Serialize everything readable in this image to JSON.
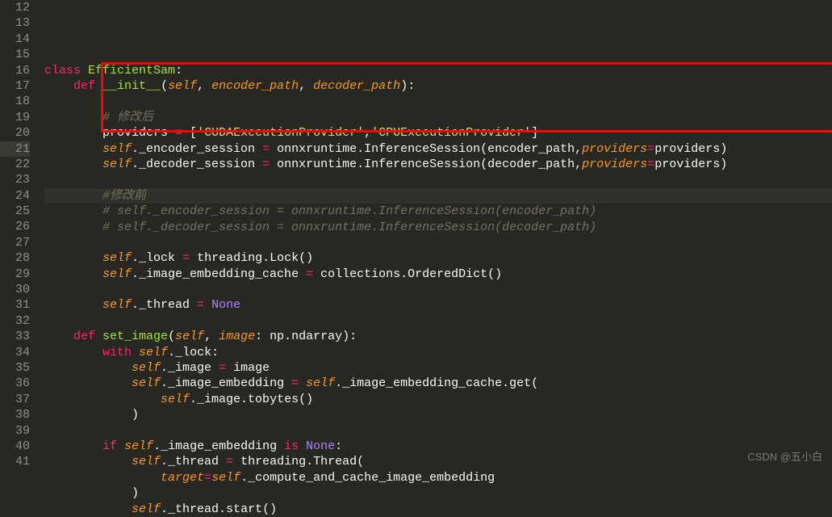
{
  "watermark": "CSDN @五小白",
  "lines": [
    {
      "num": "12",
      "tokens": []
    },
    {
      "num": "13",
      "tokens": [
        {
          "c": "kw",
          "t": "class"
        },
        {
          "c": "txt",
          "t": " "
        },
        {
          "c": "cls",
          "t": "EfficientSam"
        },
        {
          "c": "pun",
          "t": ":"
        }
      ]
    },
    {
      "num": "14",
      "tokens": [
        {
          "c": "txt",
          "t": "    "
        },
        {
          "c": "kw",
          "t": "def"
        },
        {
          "c": "txt",
          "t": " "
        },
        {
          "c": "fn",
          "t": "__init__"
        },
        {
          "c": "pun",
          "t": "("
        },
        {
          "c": "prm",
          "t": "self"
        },
        {
          "c": "pun",
          "t": ", "
        },
        {
          "c": "prm",
          "t": "encoder_path"
        },
        {
          "c": "pun",
          "t": ", "
        },
        {
          "c": "prm",
          "t": "decoder_path"
        },
        {
          "c": "pun",
          "t": "):"
        }
      ]
    },
    {
      "num": "15",
      "tokens": []
    },
    {
      "num": "16",
      "tokens": [
        {
          "c": "txt",
          "t": "        "
        },
        {
          "c": "cmt",
          "t": "# 修改后"
        }
      ]
    },
    {
      "num": "17",
      "tokens": [
        {
          "c": "txt",
          "t": "        providers "
        },
        {
          "c": "op",
          "t": "="
        },
        {
          "c": "txt",
          "t": " ["
        },
        {
          "c": "str",
          "t": "'CUDAExecutionProvider'"
        },
        {
          "c": "pun",
          "t": ","
        },
        {
          "c": "str",
          "t": "'CPUExecutionProvider'"
        },
        {
          "c": "pun",
          "t": "]"
        }
      ]
    },
    {
      "num": "18",
      "tokens": [
        {
          "c": "txt",
          "t": "        "
        },
        {
          "c": "slf",
          "t": "self"
        },
        {
          "c": "txt",
          "t": "._encoder_session "
        },
        {
          "c": "op",
          "t": "="
        },
        {
          "c": "txt",
          "t": " onnxruntime.InferenceSession(encoder_path,"
        },
        {
          "c": "prm",
          "t": "providers"
        },
        {
          "c": "op",
          "t": "="
        },
        {
          "c": "txt",
          "t": "providers)"
        }
      ]
    },
    {
      "num": "19",
      "tokens": [
        {
          "c": "txt",
          "t": "        "
        },
        {
          "c": "slf",
          "t": "self"
        },
        {
          "c": "txt",
          "t": "._decoder_session "
        },
        {
          "c": "op",
          "t": "="
        },
        {
          "c": "txt",
          "t": " onnxruntime.InferenceSession(decoder_path,"
        },
        {
          "c": "prm",
          "t": "providers"
        },
        {
          "c": "op",
          "t": "="
        },
        {
          "c": "txt",
          "t": "providers)"
        }
      ]
    },
    {
      "num": "20",
      "tokens": []
    },
    {
      "num": "21",
      "active": true,
      "tokens": [
        {
          "c": "txt",
          "t": "        "
        },
        {
          "c": "cmt",
          "t": "#修改前"
        }
      ]
    },
    {
      "num": "22",
      "tokens": [
        {
          "c": "txt",
          "t": "        "
        },
        {
          "c": "cmt",
          "t": "# self._encoder_session = onnxruntime.InferenceSession(encoder_path)"
        }
      ]
    },
    {
      "num": "23",
      "tokens": [
        {
          "c": "txt",
          "t": "        "
        },
        {
          "c": "cmt",
          "t": "# self._decoder_session = onnxruntime.InferenceSession(decoder_path)"
        }
      ]
    },
    {
      "num": "24",
      "tokens": []
    },
    {
      "num": "25",
      "tokens": [
        {
          "c": "txt",
          "t": "        "
        },
        {
          "c": "slf",
          "t": "self"
        },
        {
          "c": "txt",
          "t": "._lock "
        },
        {
          "c": "op",
          "t": "="
        },
        {
          "c": "txt",
          "t": " threading.Lock()"
        }
      ]
    },
    {
      "num": "26",
      "tokens": [
        {
          "c": "txt",
          "t": "        "
        },
        {
          "c": "slf",
          "t": "self"
        },
        {
          "c": "txt",
          "t": "._image_embedding_cache "
        },
        {
          "c": "op",
          "t": "="
        },
        {
          "c": "txt",
          "t": " collections.OrderedDict()"
        }
      ]
    },
    {
      "num": "27",
      "tokens": []
    },
    {
      "num": "28",
      "tokens": [
        {
          "c": "txt",
          "t": "        "
        },
        {
          "c": "slf",
          "t": "self"
        },
        {
          "c": "txt",
          "t": "._thread "
        },
        {
          "c": "op",
          "t": "="
        },
        {
          "c": "txt",
          "t": " "
        },
        {
          "c": "const",
          "t": "None"
        }
      ]
    },
    {
      "num": "29",
      "tokens": []
    },
    {
      "num": "30",
      "tokens": [
        {
          "c": "txt",
          "t": "    "
        },
        {
          "c": "kw",
          "t": "def"
        },
        {
          "c": "txt",
          "t": " "
        },
        {
          "c": "fn",
          "t": "set_image"
        },
        {
          "c": "pun",
          "t": "("
        },
        {
          "c": "prm",
          "t": "self"
        },
        {
          "c": "pun",
          "t": ", "
        },
        {
          "c": "prm",
          "t": "image"
        },
        {
          "c": "pun",
          "t": ": "
        },
        {
          "c": "txt",
          "t": "np.ndarray"
        },
        {
          "c": "pun",
          "t": "):"
        }
      ]
    },
    {
      "num": "31",
      "tokens": [
        {
          "c": "txt",
          "t": "        "
        },
        {
          "c": "kw",
          "t": "with"
        },
        {
          "c": "txt",
          "t": " "
        },
        {
          "c": "slf",
          "t": "self"
        },
        {
          "c": "txt",
          "t": "._lock:"
        }
      ]
    },
    {
      "num": "32",
      "tokens": [
        {
          "c": "txt",
          "t": "            "
        },
        {
          "c": "slf",
          "t": "self"
        },
        {
          "c": "txt",
          "t": "._image "
        },
        {
          "c": "op",
          "t": "="
        },
        {
          "c": "txt",
          "t": " image"
        }
      ]
    },
    {
      "num": "33",
      "tokens": [
        {
          "c": "txt",
          "t": "            "
        },
        {
          "c": "slf",
          "t": "self"
        },
        {
          "c": "txt",
          "t": "._image_embedding "
        },
        {
          "c": "op",
          "t": "="
        },
        {
          "c": "txt",
          "t": " "
        },
        {
          "c": "slf",
          "t": "self"
        },
        {
          "c": "txt",
          "t": "._image_embedding_cache.get("
        }
      ]
    },
    {
      "num": "34",
      "tokens": [
        {
          "c": "txt",
          "t": "                "
        },
        {
          "c": "slf",
          "t": "self"
        },
        {
          "c": "txt",
          "t": "._image.tobytes()"
        }
      ]
    },
    {
      "num": "35",
      "tokens": [
        {
          "c": "txt",
          "t": "            )"
        }
      ]
    },
    {
      "num": "36",
      "tokens": []
    },
    {
      "num": "37",
      "tokens": [
        {
          "c": "txt",
          "t": "        "
        },
        {
          "c": "kw",
          "t": "if"
        },
        {
          "c": "txt",
          "t": " "
        },
        {
          "c": "slf",
          "t": "self"
        },
        {
          "c": "txt",
          "t": "._image_embedding "
        },
        {
          "c": "kw",
          "t": "is"
        },
        {
          "c": "txt",
          "t": " "
        },
        {
          "c": "const",
          "t": "None"
        },
        {
          "c": "pun",
          "t": ":"
        }
      ]
    },
    {
      "num": "38",
      "tokens": [
        {
          "c": "txt",
          "t": "            "
        },
        {
          "c": "slf",
          "t": "self"
        },
        {
          "c": "txt",
          "t": "._thread "
        },
        {
          "c": "op",
          "t": "="
        },
        {
          "c": "txt",
          "t": " threading.Thread("
        }
      ]
    },
    {
      "num": "39",
      "tokens": [
        {
          "c": "txt",
          "t": "                "
        },
        {
          "c": "prm",
          "t": "target"
        },
        {
          "c": "op",
          "t": "="
        },
        {
          "c": "slf",
          "t": "self"
        },
        {
          "c": "txt",
          "t": "._compute_and_cache_image_embedding"
        }
      ]
    },
    {
      "num": "40",
      "tokens": [
        {
          "c": "txt",
          "t": "            )"
        }
      ]
    },
    {
      "num": "41",
      "tokens": [
        {
          "c": "txt",
          "t": "            "
        },
        {
          "c": "slf",
          "t": "self"
        },
        {
          "c": "txt",
          "t": "._thread.start()"
        }
      ]
    }
  ]
}
